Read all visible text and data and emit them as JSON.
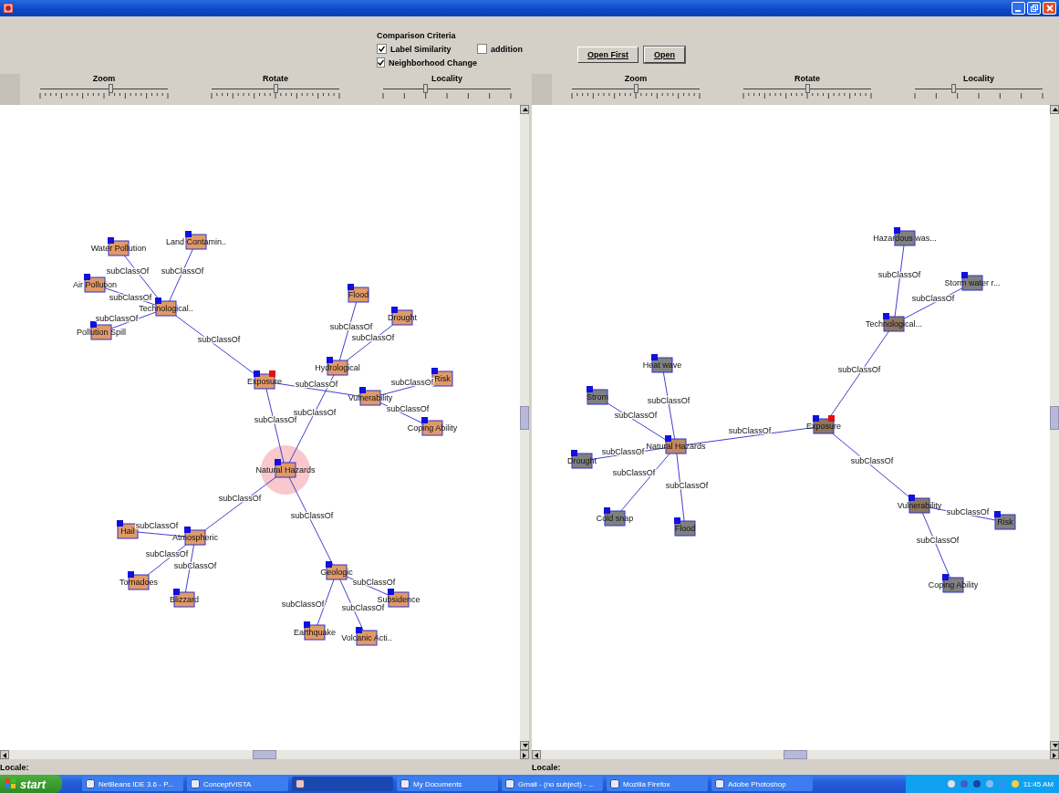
{
  "criteria": {
    "title": "Comparison Criteria",
    "options": [
      {
        "label": "Label Similarity",
        "checked": true
      },
      {
        "label": "addition",
        "checked": false
      },
      {
        "label": "Neighborhood Change",
        "checked": true
      }
    ]
  },
  "buttons": [
    {
      "label": "Open First"
    },
    {
      "label": "Open"
    }
  ],
  "panels": [
    {
      "sliders": [
        {
          "label": "Zoom",
          "level": 0.55,
          "kind": "fine"
        },
        {
          "label": "Rotate",
          "level": 0.5,
          "kind": "fine"
        },
        {
          "label": "Locality",
          "level": 0.33,
          "kind": "coarse"
        }
      ],
      "graph": {
        "label": "Natural Hazards",
        "color": "#e09a68",
        "selected": true,
        "flagged": false,
        "children": [
          {
            "label": "Exposure",
            "edge_label": "subClassOf",
            "color": "#e09a68",
            "selected": false,
            "flagged": true,
            "children": [
              {
                "label": "Technological..",
                "edge_label": "subClassOf",
                "color": "#e09a68",
                "selected": false,
                "flagged": false,
                "children": [
                  {
                    "label": "Water Pollution",
                    "edge_label": "subClassOf",
                    "color": "#e09a68",
                    "selected": false,
                    "flagged": false
                  },
                  {
                    "label": "Land Contamin..",
                    "edge_label": "subClassOf",
                    "color": "#e09a68",
                    "selected": false,
                    "flagged": false
                  },
                  {
                    "label": "Air Pollution",
                    "edge_label": "subClassOf",
                    "color": "#e09a68",
                    "selected": false,
                    "flagged": false
                  },
                  {
                    "label": "Pollution Spill",
                    "edge_label": "subClassOf",
                    "color": "#e09a68",
                    "selected": false,
                    "flagged": false
                  }
                ]
              },
              {
                "label": "Vulnerability",
                "edge_label": "subClassOf",
                "color": "#e09a68",
                "selected": false,
                "flagged": false,
                "children": [
                  {
                    "label": "Risk",
                    "edge_label": "subClassOf",
                    "color": "#e09a68",
                    "selected": false,
                    "flagged": false
                  },
                  {
                    "label": "Coping Ability",
                    "edge_label": "subClassOf",
                    "color": "#e09a68",
                    "selected": false,
                    "flagged": false
                  }
                ]
              }
            ]
          },
          {
            "label": "Hydrological",
            "edge_label": "subClassOf",
            "color": "#e09a68",
            "selected": false,
            "flagged": false,
            "children": [
              {
                "label": "Flood",
                "edge_label": "subClassOf",
                "color": "#e09a68",
                "selected": false,
                "flagged": false
              },
              {
                "label": "Drought",
                "edge_label": "subClassOf",
                "color": "#e09a68",
                "selected": false,
                "flagged": false
              }
            ]
          },
          {
            "label": "Atmospheric",
            "edge_label": "subClassOf",
            "color": "#e09a68",
            "selected": false,
            "flagged": false,
            "children": [
              {
                "label": "Hail",
                "edge_label": "subClassOf",
                "color": "#e09a68",
                "selected": false,
                "flagged": false
              },
              {
                "label": "Tornadoes",
                "edge_label": "subClassOf",
                "color": "#e09a68",
                "selected": false,
                "flagged": false
              },
              {
                "label": "Blizzard",
                "edge_label": "subClassOf",
                "color": "#e09a68",
                "selected": false,
                "flagged": false
              }
            ]
          },
          {
            "label": "Geologic",
            "edge_label": "subClassOf",
            "color": "#e09a68",
            "selected": false,
            "flagged": false,
            "children": [
              {
                "label": "Subsidence",
                "edge_label": "subClassOf",
                "color": "#e09a68",
                "selected": false,
                "flagged": false
              },
              {
                "label": "Earthquake",
                "edge_label": "subClassOf",
                "color": "#e09a68",
                "selected": false,
                "flagged": false
              },
              {
                "label": "Volcanic Acti..",
                "edge_label": "subClassOf",
                "color": "#e09a68",
                "selected": false,
                "flagged": false
              }
            ]
          }
        ]
      },
      "locale_label": "Locale:"
    },
    {
      "sliders": [
        {
          "label": "Zoom",
          "level": 0.5,
          "kind": "fine"
        },
        {
          "label": "Rotate",
          "level": 0.5,
          "kind": "fine"
        },
        {
          "label": "Locality",
          "level": 0.3,
          "kind": "coarse"
        }
      ],
      "graph": {
        "label": "Exposure",
        "color": "#8c7660",
        "selected": false,
        "flagged": true,
        "children": [
          {
            "label": "Technological...",
            "edge_label": "subClassOf",
            "color": "#8c7660",
            "selected": false,
            "flagged": false,
            "children": [
              {
                "label": "Hazardous was...",
                "edge_label": "subClassOf",
                "color": "#808080",
                "selected": false,
                "flagged": false
              },
              {
                "label": "Storm water r...",
                "edge_label": "subClassOf",
                "color": "#808080",
                "selected": false,
                "flagged": false
              }
            ]
          },
          {
            "label": "Natural Hazards",
            "edge_label": "subClassOf",
            "color": "#c08860",
            "selected": false,
            "flagged": false,
            "children": [
              {
                "label": "Heat wave",
                "edge_label": "subClassOf",
                "color": "#808080",
                "selected": false,
                "flagged": false
              },
              {
                "label": "Strom",
                "edge_label": "subClassOf",
                "color": "#808080",
                "selected": false,
                "flagged": false
              },
              {
                "label": "Drought",
                "edge_label": "subClassOf",
                "color": "#808080",
                "selected": false,
                "flagged": false
              },
              {
                "label": "Cold snap",
                "edge_label": "subClassOf",
                "color": "#808080",
                "selected": false,
                "flagged": false
              },
              {
                "label": "Flood",
                "edge_label": "subClassOf",
                "color": "#808080",
                "selected": false,
                "flagged": false
              }
            ]
          },
          {
            "label": "Vulnerability",
            "edge_label": "subClassOf",
            "color": "#8c7660",
            "selected": false,
            "flagged": false,
            "children": [
              {
                "label": "Risk",
                "edge_label": "subClassOf",
                "color": "#808080",
                "selected": false,
                "flagged": false
              },
              {
                "label": "Coping Ability",
                "edge_label": "subClassOf",
                "color": "#808080",
                "selected": false,
                "flagged": false
              }
            ]
          }
        ]
      },
      "locale_label": "Locale:"
    }
  ],
  "taskbar": {
    "start": "start",
    "items": [
      {
        "label": "NetBeans IDE 3.6 - P...",
        "selected": false
      },
      {
        "label": "ConceptVISTA",
        "selected": false
      },
      {
        "selected": true
      },
      {
        "label": "My Documents",
        "selected": false
      },
      {
        "label": "Gmail - (no subject) - ...",
        "selected": false
      },
      {
        "label": "Mozilla Firefox",
        "selected": false
      },
      {
        "label": "Adobe Photoshop",
        "selected": false
      }
    ],
    "clock": "11:45 AM"
  }
}
